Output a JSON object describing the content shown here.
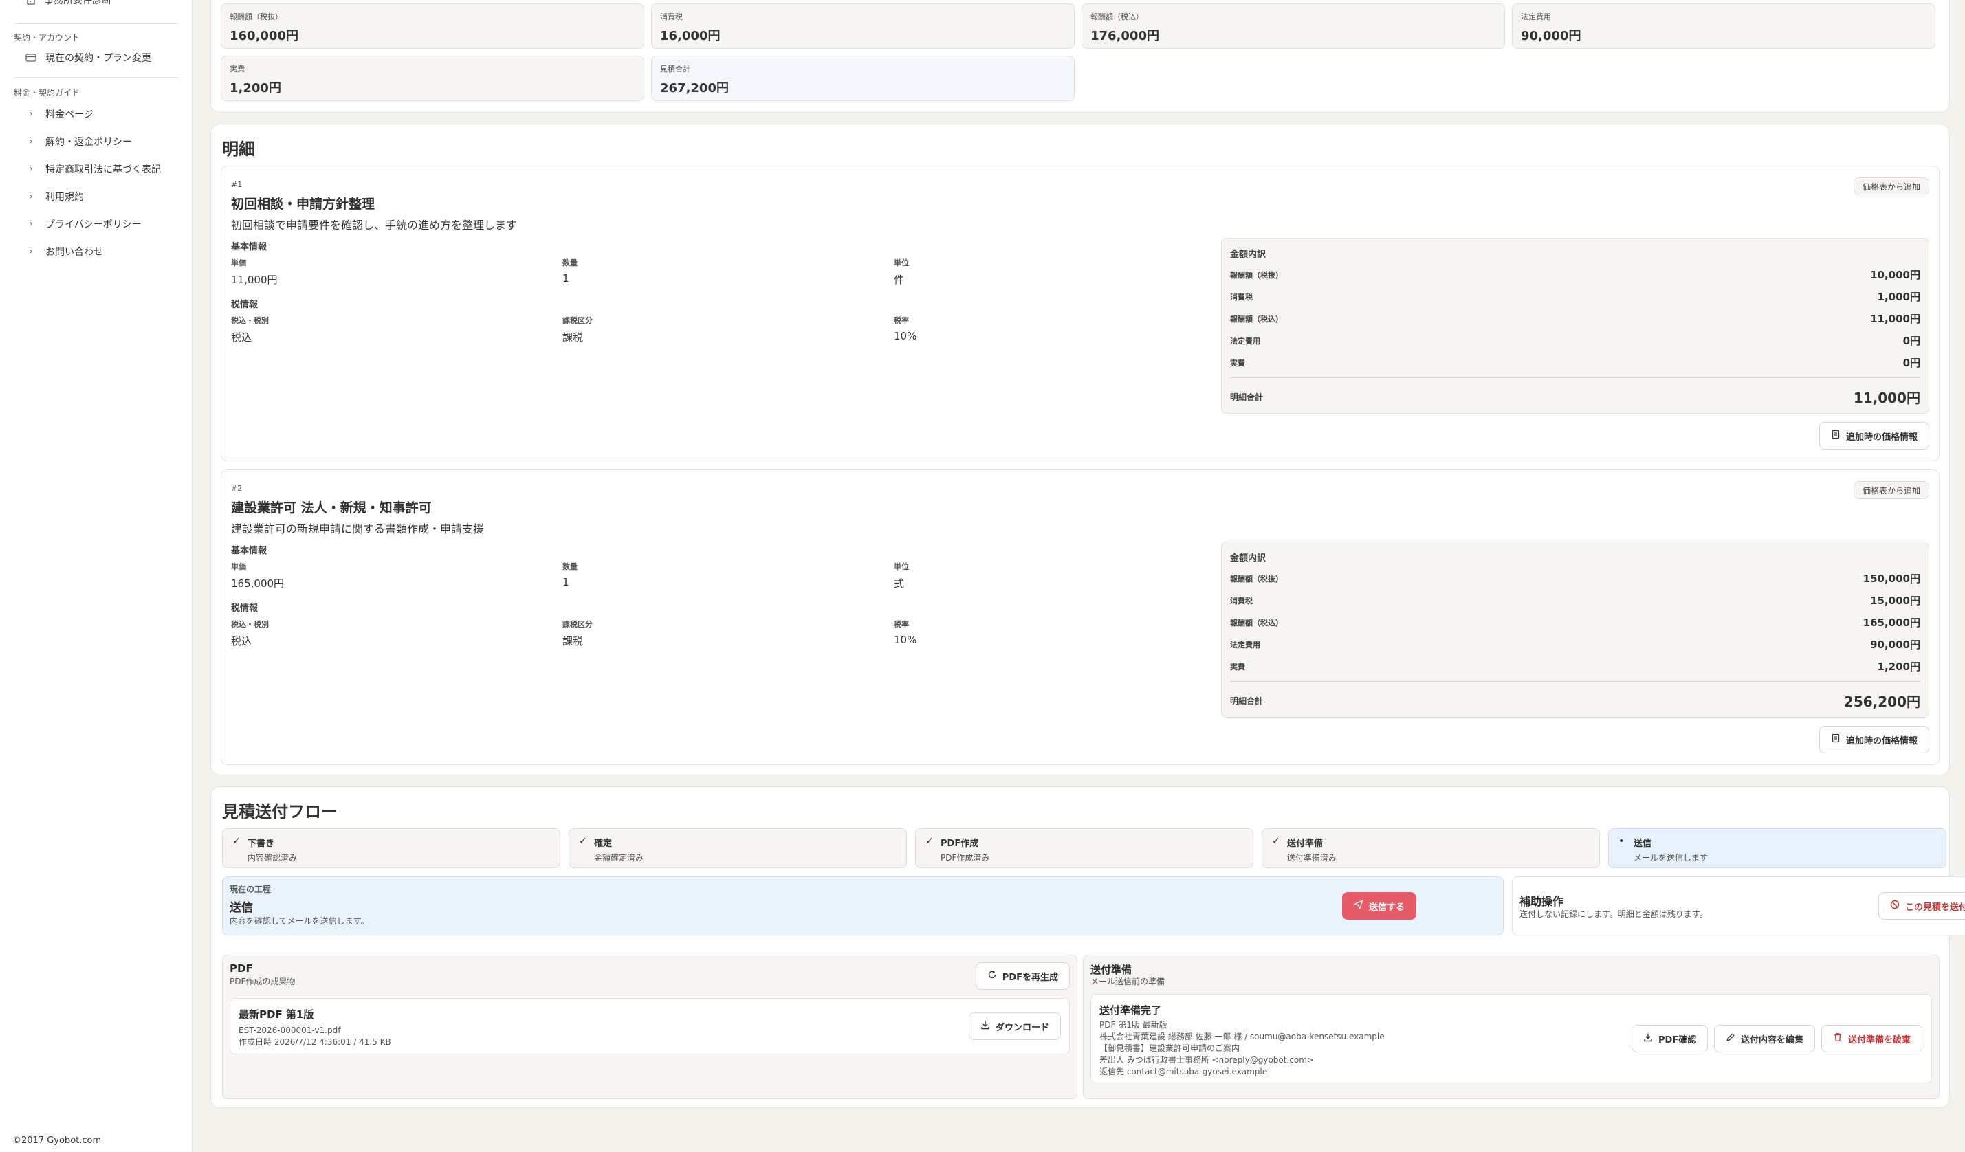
{
  "sidebar": {
    "top_item": "事務所要件診断",
    "account_heading": "契約・アカウント",
    "account_item": "現在の契約・プラン変更",
    "guide_heading": "料金・契約ガイド",
    "guide_items": [
      "料金ページ",
      "解約・返金ポリシー",
      "特定商取引法に基づく表記",
      "利用規約",
      "プライバシーポリシー",
      "お問い合わせ"
    ]
  },
  "summary": [
    {
      "label": "報酬額（税抜）",
      "value": "160,000円"
    },
    {
      "label": "消費税",
      "value": "16,000円"
    },
    {
      "label": "報酬額（税込）",
      "value": "176,000円"
    },
    {
      "label": "法定費用",
      "value": "90,000円"
    },
    {
      "label": "実費",
      "value": "1,200円"
    },
    {
      "label": "見積合計",
      "value": "267,200円"
    }
  ],
  "details": {
    "title": "明細",
    "source_pill": "価格表から追加",
    "basic_info": "基本情報",
    "tax_info": "税情報",
    "labels": {
      "unit_price": "単価",
      "quantity": "数量",
      "unit": "単位",
      "tax_incl": "税込・税別",
      "tax_class": "課税区分",
      "tax_rate": "税率"
    },
    "amount_title": "金額内訳",
    "amount_labels": [
      "報酬額（税抜）",
      "消費税",
      "報酬額（税込）",
      "法定費用",
      "実費"
    ],
    "total_label": "明細合計",
    "price_info_button": "追加時の価格情報",
    "items": [
      {
        "num": "#1",
        "name": "初回相談・申請方針整理",
        "desc": "初回相談で申請要件を確認し、手続の進め方を整理します",
        "unit_price": "11,000円",
        "quantity": "1",
        "unit": "件",
        "tax_incl": "税込",
        "tax_class": "課税",
        "tax_rate": "10%",
        "amounts": [
          "10,000円",
          "1,000円",
          "11,000円",
          "0円",
          "0円"
        ],
        "total": "11,000円"
      },
      {
        "num": "#2",
        "name": "建設業許可 法人・新規・知事許可",
        "desc": "建設業許可の新規申請に関する書類作成・申請支援",
        "unit_price": "165,000円",
        "quantity": "1",
        "unit": "式",
        "tax_incl": "税込",
        "tax_class": "課税",
        "tax_rate": "10%",
        "amounts": [
          "150,000円",
          "15,000円",
          "165,000円",
          "90,000円",
          "1,200円"
        ],
        "total": "256,200円"
      }
    ]
  },
  "flow": {
    "title": "見積送付フロー",
    "steps": [
      {
        "mark": "✓",
        "title": "下書き",
        "sub": "内容確認済み"
      },
      {
        "mark": "✓",
        "title": "確定",
        "sub": "金額確定済み"
      },
      {
        "mark": "✓",
        "title": "PDF作成",
        "sub": "PDF作成済み"
      },
      {
        "mark": "✓",
        "title": "送付準備",
        "sub": "送付準備済み"
      },
      {
        "mark": "•",
        "title": "送信",
        "sub": "メールを送信します"
      }
    ],
    "current": {
      "label": "現在の工程",
      "title": "送信",
      "desc": "内容を確認してメールを送信します。",
      "send_button": "送信する"
    },
    "aux": {
      "title": "補助操作",
      "desc": "送付しない記録にします。明細と金額は残ります。",
      "button": "この見積を送付しない"
    },
    "pdf": {
      "title": "PDF",
      "sub": "PDF作成の成果物",
      "regen_button": "PDFを再生成",
      "latest": "最新PDF 第1版",
      "file": "EST-2026-000001-v1.pdf",
      "created": "作成日時 2026/7/12 4:36:01 / 41.5 KB",
      "download_button": "ダウンロード"
    },
    "prep": {
      "title": "送付準備",
      "sub": "メール送信前の準備",
      "status": "送付準備完了",
      "lines": [
        "PDF 第1版 最新版",
        "株式会社青葉建設 総務部 佐藤 一郎 様 / soumu@aoba-kensetsu.example",
        "【御見積書】建設業許可申請のご案内",
        "差出人 みつば行政書士事務所 <noreply@gyobot.com>",
        "返信先 contact@mitsuba-gyosei.example"
      ],
      "buttons": {
        "pdf_check": "PDF確認",
        "edit": "送付内容を編集",
        "discard": "送付準備を破棄"
      }
    }
  },
  "footer": "©2017 Gyobot.com"
}
